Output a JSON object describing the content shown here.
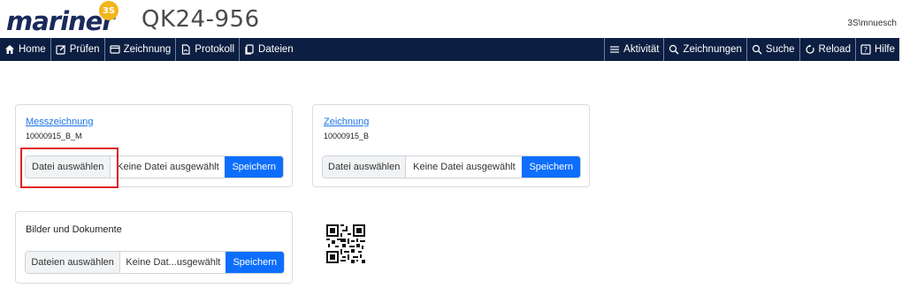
{
  "brand": {
    "logo_text": "mariner",
    "badge_text": "3S"
  },
  "header": {
    "title": "QK24-956",
    "user": "3S\\mnuesch"
  },
  "nav": {
    "left": [
      {
        "label": "Home",
        "icon": "home-icon"
      },
      {
        "label": "Prüfen",
        "icon": "edit-icon"
      },
      {
        "label": "Zeichnung",
        "icon": "window-icon"
      },
      {
        "label": "Protokoll",
        "icon": "document-icon"
      },
      {
        "label": "Dateien",
        "icon": "files-icon"
      }
    ],
    "right": [
      {
        "label": "Aktivität",
        "icon": "list-icon"
      },
      {
        "label": "Zeichnungen",
        "icon": "search-icon"
      },
      {
        "label": "Suche",
        "icon": "search-icon"
      },
      {
        "label": "Reload",
        "icon": "reload-icon"
      },
      {
        "label": "Hilfe",
        "icon": "help-icon"
      }
    ]
  },
  "cards": {
    "messzeichnung": {
      "link": "Messzeichnung",
      "sub": "10000915_B_M",
      "choose_label": "Datei auswählen",
      "status": "Keine Datei ausgewählt",
      "save_label": "Speichern"
    },
    "zeichnung": {
      "link": "Zeichnung",
      "sub": "10000915_B",
      "choose_label": "Datei auswählen",
      "status": "Keine Datei ausgewählt",
      "save_label": "Speichern"
    },
    "bilder": {
      "heading": "Bilder und Dokumente",
      "choose_label": "Dateien auswählen",
      "status": "Keine Dat...usgewählt",
      "save_label": "Speichern"
    }
  },
  "colors": {
    "navbar": "#0c1f42",
    "primary": "#0d6efd",
    "link": "#1a73e8",
    "highlight": "#e02020",
    "logo": "#1a2a5c",
    "badge": "#f3b51d"
  }
}
